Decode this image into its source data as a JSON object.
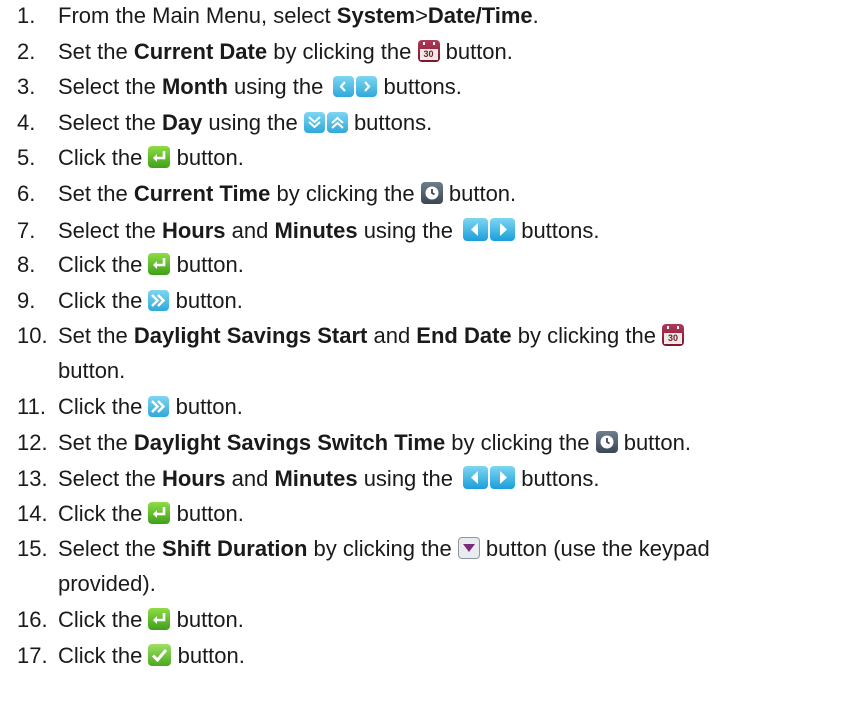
{
  "steps": [
    {
      "num": "1.",
      "a": "From the Main Menu, select ",
      "b1": "System",
      "c": ">",
      "b2": "Date/Time",
      "d": "."
    },
    {
      "num": "2.",
      "a": "Set the ",
      "b1": "Current Date",
      "c": " by clicking the ",
      "d": " button."
    },
    {
      "num": "3.",
      "a": "Select the ",
      "b1": "Month",
      "c": " using the ",
      "d": " buttons."
    },
    {
      "num": "4.",
      "a": "Select the ",
      "b1": "Day",
      "c": " using the ",
      "d": " buttons."
    },
    {
      "num": "5.",
      "a": "Click the ",
      "d": " button."
    },
    {
      "num": "6.",
      "a": "Set the ",
      "b1": "Current Time",
      "c": " by clicking the ",
      "d": " button."
    },
    {
      "num": "7.",
      "a": "Select the ",
      "b1": "Hours",
      "c": " and ",
      "b2": "Minutes",
      "e": " using the ",
      "d": " buttons."
    },
    {
      "num": "8.",
      "a": "Click the ",
      "d": " button."
    },
    {
      "num": "9.",
      "a": "Click the ",
      "d": " button."
    },
    {
      "num": "10.",
      "a": "Set the ",
      "b1": "Daylight Savings Start",
      "c": " and ",
      "b2": "End Date",
      "e": " by clicking the ",
      "d": "button."
    },
    {
      "num": "11.",
      "a": "Click the ",
      "d": " button."
    },
    {
      "num": "12.",
      "a": "Set the ",
      "b1": "Daylight Savings Switch Time",
      "c": " by clicking the ",
      "d": " button."
    },
    {
      "num": "13.",
      "a": "Select the ",
      "b1": "Hours",
      "c": " and ",
      "b2": "Minutes",
      "e": " using the ",
      "d": " buttons."
    },
    {
      "num": "14.",
      "a": "Click the ",
      "d": " button."
    },
    {
      "num": "15.",
      "a": "Select the ",
      "b1": "Shift Duration",
      "c": " by clicking the ",
      "d": " button (use the keypad",
      "f": "provided)."
    },
    {
      "num": "16.",
      "a": "Click the ",
      "d": " button."
    },
    {
      "num": "17.",
      "a": "Click the ",
      "d": " button."
    }
  ],
  "calendar_icon_text": "30",
  "icons": {
    "calendar": "calendar-icon",
    "month_prev_next": "chevron-left-right-icon",
    "day_down_up": "double-chevron-down-up-icon",
    "enter": "enter-icon",
    "clock": "clock-icon",
    "hour_prev_next": "triangle-left-right-icon",
    "next": "fast-forward-icon",
    "dropdown": "dropdown-icon",
    "confirm": "checkmark-icon"
  },
  "colors": {
    "text": "#1a1a1a",
    "calendar": "#8b1e3a",
    "blue": "#2ea9db",
    "green": "#4aa81e",
    "gray": "#4a5863"
  }
}
